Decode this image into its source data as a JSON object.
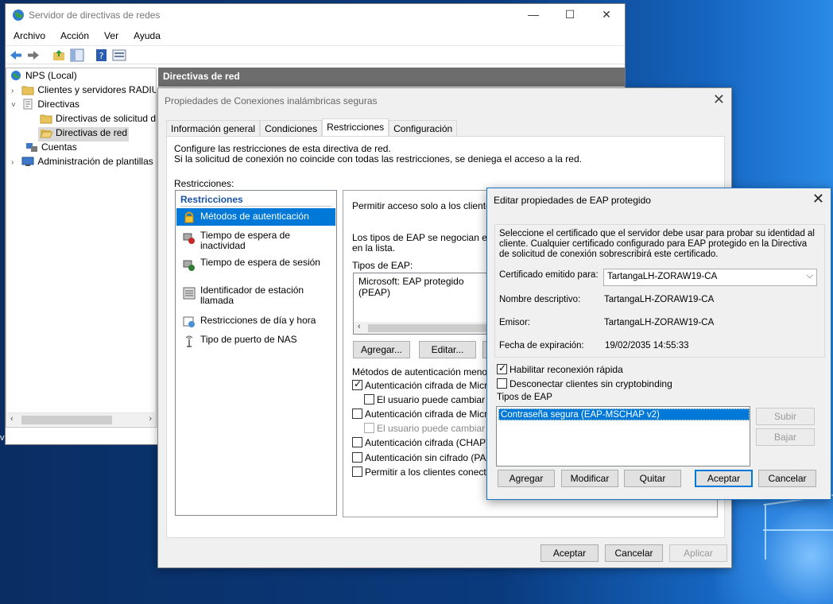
{
  "desktop": {
    "edge_text": "v"
  },
  "main_window": {
    "title": "Servidor de directivas de redes",
    "caption": {
      "minimize": "—",
      "maximize": "☐",
      "close": "✕"
    },
    "menu": [
      "Archivo",
      "Acción",
      "Ver",
      "Ayuda"
    ],
    "tree": [
      {
        "label": "NPS (Local)",
        "icon": "nps-icon",
        "level": 0,
        "expander": ""
      },
      {
        "label": "Clientes y servidores RADIUS",
        "icon": "folder-icon",
        "level": 1,
        "expander": "›"
      },
      {
        "label": "Directivas",
        "icon": "policy-icon",
        "level": 1,
        "expander": "˅"
      },
      {
        "label": "Directivas de solicitud de conexión",
        "icon": "folder-icon",
        "level": 2,
        "expander": ""
      },
      {
        "label": "Directivas de red",
        "icon": "folder-open-icon",
        "level": 2,
        "expander": "",
        "selected": true
      },
      {
        "label": "Cuentas",
        "icon": "accounts-icon",
        "level": 1,
        "expander": ""
      },
      {
        "label": "Administración de plantillas",
        "icon": "templates-icon",
        "level": 1,
        "expander": "›"
      }
    ],
    "right_header": "Directivas de red"
  },
  "prop_dialog": {
    "title": "Propiedades de Conexiones inalámbricas seguras",
    "tabs": [
      "Información general",
      "Condiciones",
      "Restricciones",
      "Configuración"
    ],
    "active_tab": "Restricciones",
    "intro_line1": "Configure las restricciones de esta directiva de red.",
    "intro_line2": "Si la solicitud de conexión no coincide con todas las restricciones, se deniega el acceso a la red.",
    "restrictions_label": "Restricciones:",
    "list_header": "Restricciones",
    "items": [
      "Métodos de autenticación",
      "Tiempo de espera de inactividad",
      "Tiempo de espera de sesión",
      "Identificador de estación llamada",
      "Restricciones de día y hora",
      "Tipo de puerto de NAS"
    ],
    "detail": {
      "allow_text": "Permitir acceso solo a los clientes qu",
      "eap_neg_1": "Los tipos de EAP se negocian entre",
      "eap_neg_2": "en la lista.",
      "eap_types_label": "Tipos de EAP:",
      "eap_types": [
        "Microsoft: EAP protegido (PEAP)"
      ],
      "add_btn": "Agregar...",
      "edit_btn": "Editar...",
      "less_secure_label": "Métodos de autenticación menos se",
      "checks": [
        {
          "label": "Autenticación cifrada de Microso",
          "checked": true,
          "indent": false,
          "disabled": false
        },
        {
          "label": "El usuario puede cambiar la c",
          "checked": false,
          "indent": true,
          "disabled": false
        },
        {
          "label": "Autenticación cifrada de Microso",
          "checked": false,
          "indent": false,
          "disabled": false
        },
        {
          "label": "El usuario puede cambiar la c",
          "checked": false,
          "indent": true,
          "disabled": true
        },
        {
          "label": "Autenticación cifrada (CHAP)",
          "checked": false,
          "indent": false,
          "disabled": false
        },
        {
          "label": "Autenticación sin cifrado (PAP, S",
          "checked": false,
          "indent": false,
          "disabled": false
        },
        {
          "label": "Permitir a los clientes conectarse",
          "checked": false,
          "indent": false,
          "disabled": false
        }
      ]
    },
    "buttons": {
      "ok": "Aceptar",
      "cancel": "Cancelar",
      "apply": "Aplicar"
    }
  },
  "eap_dialog": {
    "title": "Editar propiedades de EAP protegido",
    "description": "Seleccione el certificado que el servidor debe usar para probar su identidad al cliente. Cualquier certificado configurado para EAP protegido en la Directiva de solicitud de conexión sobrescribirá este certificado.",
    "cert_issued_label": "Certificado emitido para:",
    "cert_issued_value": "TartangaLH-ZORAW19-CA",
    "friendly_name_label": "Nombre descriptivo:",
    "friendly_name_value": "TartangaLH-ZORAW19-CA",
    "issuer_label": "Emisor:",
    "issuer_value": "TartangaLH-ZORAW19-CA",
    "expiration_label": "Fecha de expiración:",
    "expiration_value": "19/02/2035 14:55:33",
    "fast_reconnect_label": "Habilitar reconexión rápida",
    "fast_reconnect_checked": true,
    "disconnect_label": "Desconectar clientes sin cryptobinding",
    "disconnect_checked": false,
    "eap_types_label": "Tipos de EAP",
    "eap_types": [
      "Contraseña segura (EAP-MSCHAP v2)"
    ],
    "buttons": {
      "up": "Subir",
      "down": "Bajar",
      "add": "Agregar",
      "edit": "Modificar",
      "remove": "Quitar",
      "ok": "Aceptar",
      "cancel": "Cancelar"
    }
  }
}
